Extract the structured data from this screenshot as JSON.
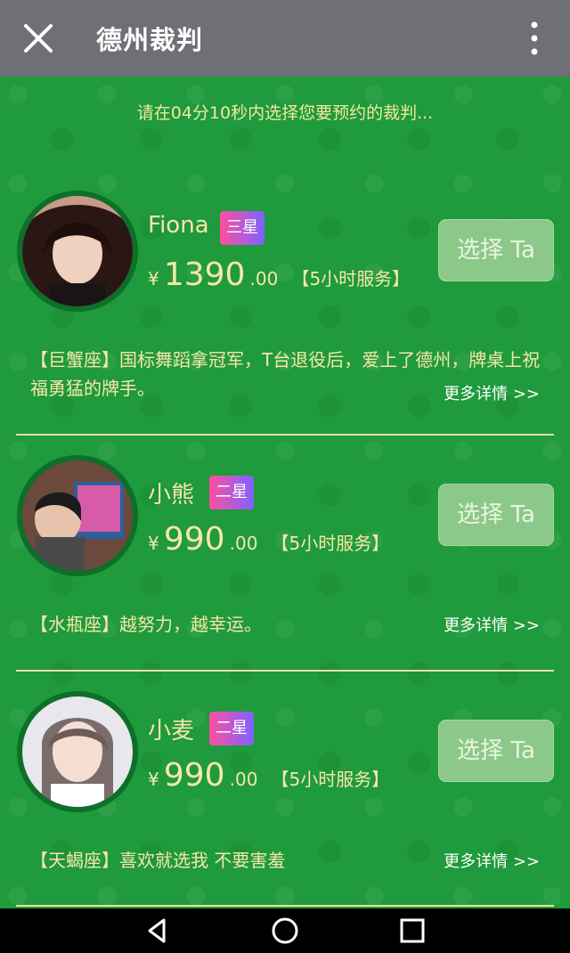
{
  "header": {
    "title": "德州裁判"
  },
  "notice": "请在04分10秒内选择您要预约的裁判...",
  "cards": [
    {
      "name": "Fiona",
      "badge": "三星",
      "price_prefix": "¥",
      "price_main": "1390",
      "price_decimal": ".00",
      "service": "【5小时服务】",
      "button": "选择 Ta",
      "description": "【巨蟹座】国标舞蹈拿冠军，T台退役后，爱上了德州，牌桌上祝福勇猛的牌手。",
      "details": "更多详情 >>"
    },
    {
      "name": "小熊",
      "badge": "二星",
      "price_prefix": "¥",
      "price_main": "990",
      "price_decimal": ".00",
      "service": "【5小时服务】",
      "button": "选择 Ta",
      "description": "【水瓶座】越努力，越幸运。",
      "details": "更多详情 >>"
    },
    {
      "name": "小麦",
      "badge": "二星",
      "price_prefix": "¥",
      "price_main": "990",
      "price_decimal": ".00",
      "service": "【5小时服务】",
      "button": "选择 Ta",
      "description": "【天蝎座】喜欢就选我 不要害羞",
      "details": "更多详情 >>"
    }
  ],
  "icons": {
    "close": "close-icon",
    "more": "more-vertical-icon",
    "back": "back-triangle-icon",
    "home": "home-circle-icon",
    "recent": "recent-square-icon"
  },
  "colors": {
    "topbar": "#6f7076",
    "background": "#1f9a3c",
    "text_gold": "#f7e7a8",
    "button": "#8cc88a"
  }
}
